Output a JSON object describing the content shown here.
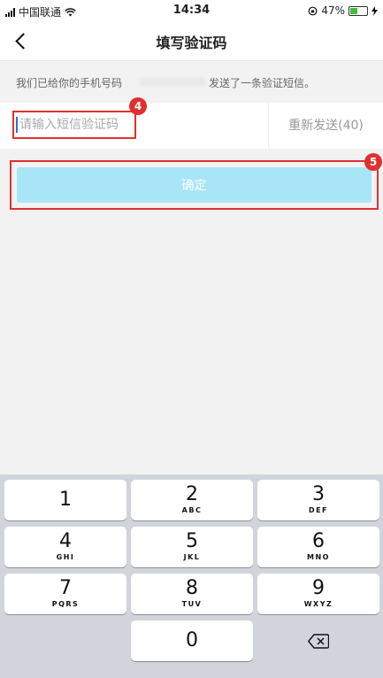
{
  "status_bar": {
    "carrier": "中国联通",
    "time": "14:34",
    "battery_percent": "47%",
    "battery_level": 0.47
  },
  "nav": {
    "title": "填写验证码",
    "back_icon": "chevron-left-icon"
  },
  "notice": {
    "prefix": "我们已给你的手机号码",
    "suffix": "发送了一条验证短信。"
  },
  "code_input": {
    "placeholder": "请输入短信验证码",
    "value": ""
  },
  "resend": {
    "label": "重新发送(40)"
  },
  "confirm": {
    "label": "确定"
  },
  "markers": {
    "input": "4",
    "confirm": "5"
  },
  "keypad": {
    "keys": [
      {
        "num": "1",
        "letters": ""
      },
      {
        "num": "2",
        "letters": "ABC"
      },
      {
        "num": "3",
        "letters": "DEF"
      },
      {
        "num": "4",
        "letters": "GHI"
      },
      {
        "num": "5",
        "letters": "JKL"
      },
      {
        "num": "6",
        "letters": "MNO"
      },
      {
        "num": "7",
        "letters": "PQRS"
      },
      {
        "num": "8",
        "letters": "TUV"
      },
      {
        "num": "9",
        "letters": "WXYZ"
      },
      {
        "num": "0",
        "letters": ""
      }
    ],
    "delete_icon": "backspace-icon"
  },
  "colors": {
    "accent_button": "#a8e5f6",
    "highlight": "#e0312f",
    "caret": "#2d6cf0"
  }
}
